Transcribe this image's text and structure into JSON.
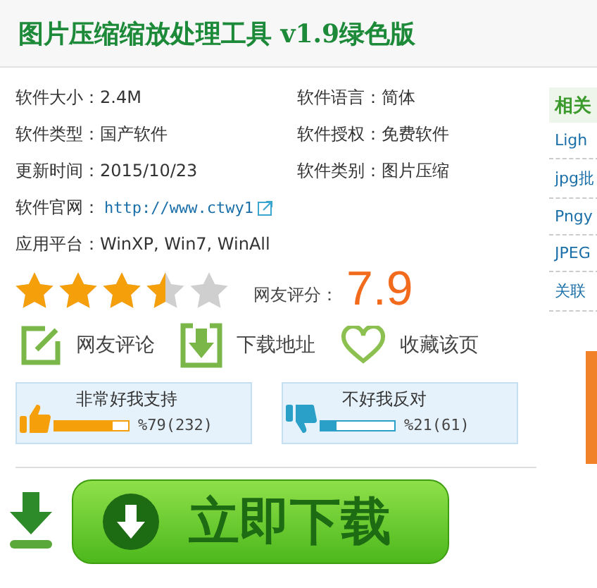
{
  "title": "图片压缩缩放处理工具 v1.9绿色版",
  "info": [
    {
      "label": "软件大小：",
      "value": "2.4M"
    },
    {
      "label": "软件语言：",
      "value": "简体"
    },
    {
      "label": "软件类型：",
      "value": "国产软件"
    },
    {
      "label": "软件授权：",
      "value": "免费软件"
    },
    {
      "label": "更新时间：",
      "value": "2015/10/23"
    },
    {
      "label": "软件类别：",
      "value": "图片压缩"
    }
  ],
  "website": {
    "label": "软件官网：",
    "link": "http://www.ctwy1"
  },
  "platform": {
    "label": "应用平台：",
    "value": "WinXP, Win7, WinAll"
  },
  "rating": {
    "stars": 3.5,
    "label": "网友评分：",
    "score": "7.9"
  },
  "actions": [
    {
      "kind": "comment",
      "label": "网友评论"
    },
    {
      "kind": "download",
      "label": "下载地址"
    },
    {
      "kind": "favorite",
      "label": "收藏该页"
    }
  ],
  "votes": [
    {
      "kind": "up",
      "label": "非常好我支持",
      "level": 0.79,
      "reading": "%79(232)"
    },
    {
      "kind": "down",
      "label": "不好我反对",
      "level": 0.21,
      "reading": "%21(61)"
    }
  ],
  "download_button": "立即下载",
  "sidebar": {
    "title": "相关",
    "links": [
      "Ligh",
      "jpg批",
      "Pngy",
      "JPEG",
      "关联"
    ]
  }
}
